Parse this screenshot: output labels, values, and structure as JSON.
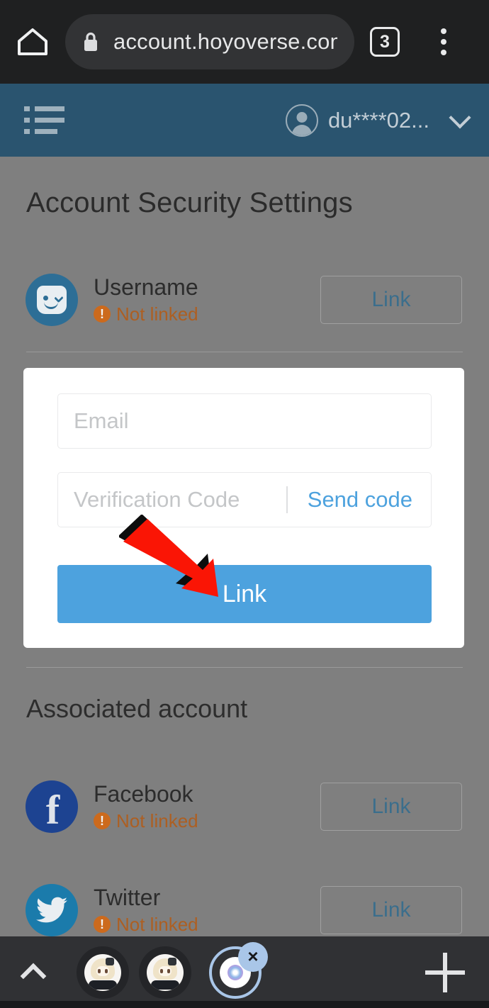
{
  "browser": {
    "home_icon": "home-icon",
    "lock_icon": "lock-icon",
    "url": "account.hoyoverse.com/",
    "tab_count": "3",
    "overflow_icon": "three-dot-menu-icon"
  },
  "site_header": {
    "menu_icon": "list-menu-icon",
    "avatar_icon": "user-avatar-icon",
    "username": "du****02...",
    "chevron_icon": "chevron-down-icon"
  },
  "page": {
    "title": "Account Security Settings",
    "section_title": "Associated account",
    "rows": [
      {
        "icon": "mihoyo-account-icon",
        "name": "Username",
        "status": "Not linked",
        "badge": "!",
        "action": "Link"
      },
      {
        "icon": "facebook-icon",
        "name": "Facebook",
        "status": "Not linked",
        "badge": "!",
        "action": "Link"
      },
      {
        "icon": "twitter-icon",
        "name": "Twitter",
        "status": "Not linked",
        "badge": "!",
        "action": "Link"
      }
    ]
  },
  "card": {
    "email_placeholder": "Email",
    "email_value": "",
    "code_placeholder": "Verification Code",
    "code_value": "",
    "send_code_label": "Send code",
    "submit_label": "Link"
  },
  "annotation": {
    "type": "red-arrow",
    "points_to": "Link",
    "color": "#fa1505"
  },
  "bottom_bar": {
    "expand_icon": "chevron-up-icon",
    "chips": [
      {
        "icon": "anime-avatar-icon"
      },
      {
        "icon": "anime-avatar-icon"
      }
    ],
    "active_item": {
      "icon": "bubble-orb-icon",
      "close_label": "×"
    },
    "add_icon": "plus-icon"
  },
  "colors": {
    "header_blue": "#2a546f",
    "overlay_gray": "#7f7f7f",
    "primary_blue": "#4da2de",
    "warn_orange": "#cc6a1d",
    "status_text": "#ad5f22",
    "browser_dark": "#1f2021",
    "bottom_bar": "#303134",
    "accent_light_blue": "#a9c6e8"
  }
}
